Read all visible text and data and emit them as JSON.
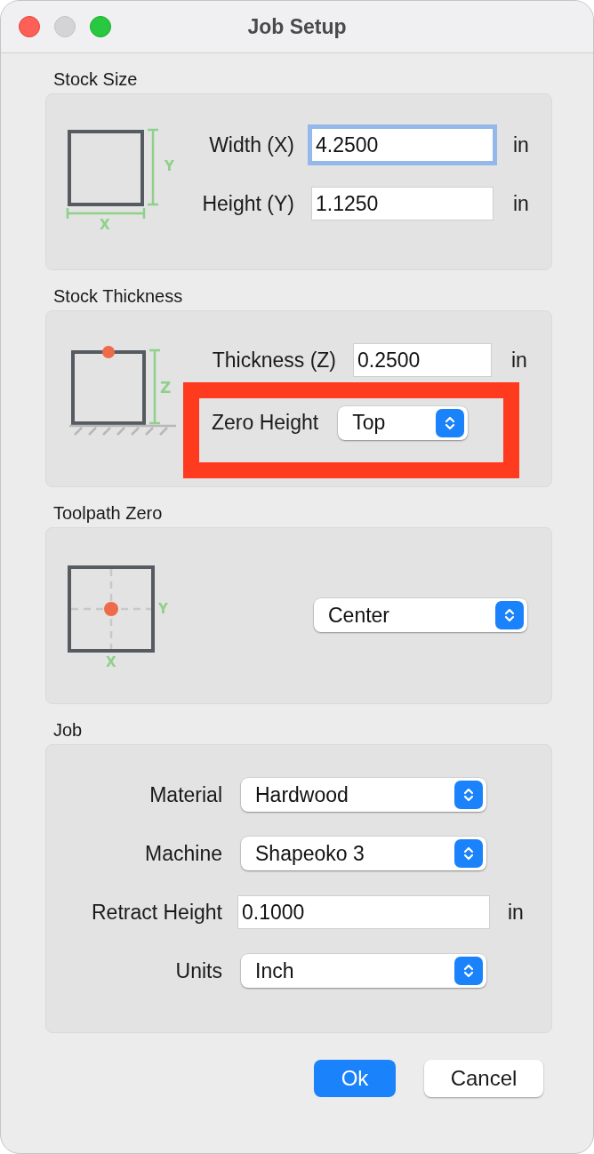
{
  "window": {
    "title": "Job Setup"
  },
  "sections": [
    {
      "kind": "stock_size",
      "title": "Stock Size",
      "diagram": {
        "x_label": "X",
        "y_label": "Y"
      },
      "rows": [
        {
          "kind": "field",
          "label": "Width (X)",
          "value": "4.2500",
          "unit": "in",
          "focused": true
        },
        {
          "kind": "field",
          "label": "Height (Y)",
          "value": "1.1250",
          "unit": "in",
          "focused": false
        }
      ]
    },
    {
      "kind": "stock_thickness",
      "title": "Stock Thickness",
      "diagram": {
        "z_label": "Z"
      },
      "rows": [
        {
          "kind": "field",
          "label": "Thickness (Z)",
          "value": "0.2500",
          "unit": "in",
          "focused": false
        },
        {
          "kind": "popup",
          "label": "Zero Height",
          "value": "Top",
          "highlighted": true
        }
      ]
    },
    {
      "kind": "toolpath_zero",
      "title": "Toolpath Zero",
      "diagram": {
        "x_label": "X",
        "y_label": "Y"
      },
      "rows": [
        {
          "kind": "popup",
          "value": "Center"
        }
      ]
    },
    {
      "kind": "job",
      "title": "Job",
      "rows": [
        {
          "kind": "popup",
          "label": "Material",
          "value": "Hardwood"
        },
        {
          "kind": "popup",
          "label": "Machine",
          "value": "Shapeoko 3"
        },
        {
          "kind": "field",
          "label": "Retract Height",
          "value": "0.1000",
          "unit": "in",
          "focused": false
        },
        {
          "kind": "popup",
          "label": "Units",
          "value": "Inch"
        }
      ]
    }
  ],
  "buttons": [
    {
      "label": "Ok",
      "default": true
    },
    {
      "label": "Cancel",
      "default": false
    }
  ]
}
